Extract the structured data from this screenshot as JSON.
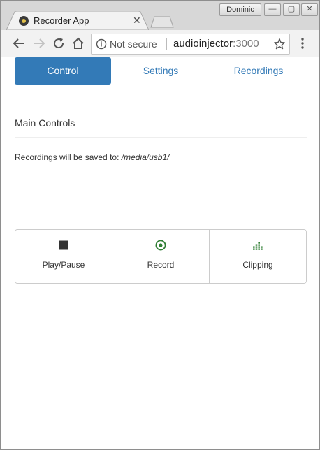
{
  "window": {
    "profile_name": "Dominic",
    "minimize_glyph": "—",
    "maximize_glyph": "▢",
    "close_glyph": "✕"
  },
  "tab": {
    "title": "Recorder App",
    "close_glyph": "✕"
  },
  "toolbar": {
    "security_text": "Not secure",
    "url_host": "audioinjector",
    "url_port": ":3000"
  },
  "nav": {
    "items": [
      {
        "label": "Control",
        "active": true
      },
      {
        "label": "Settings",
        "active": false
      },
      {
        "label": "Recordings",
        "active": false
      }
    ]
  },
  "main": {
    "title": "Main Controls",
    "save_prefix": "Recordings will be saved to: ",
    "save_path": "/media/usb1/"
  },
  "controls": {
    "buttons": [
      {
        "label": "Play/Pause",
        "icon": "stop-icon",
        "color": "#333333"
      },
      {
        "label": "Record",
        "icon": "record-icon",
        "color": "#2e7d32"
      },
      {
        "label": "Clipping",
        "icon": "equalizer-icon",
        "color": "#2e7d32"
      }
    ]
  },
  "colors": {
    "accent": "#337ab7",
    "green": "#2e7d32"
  }
}
